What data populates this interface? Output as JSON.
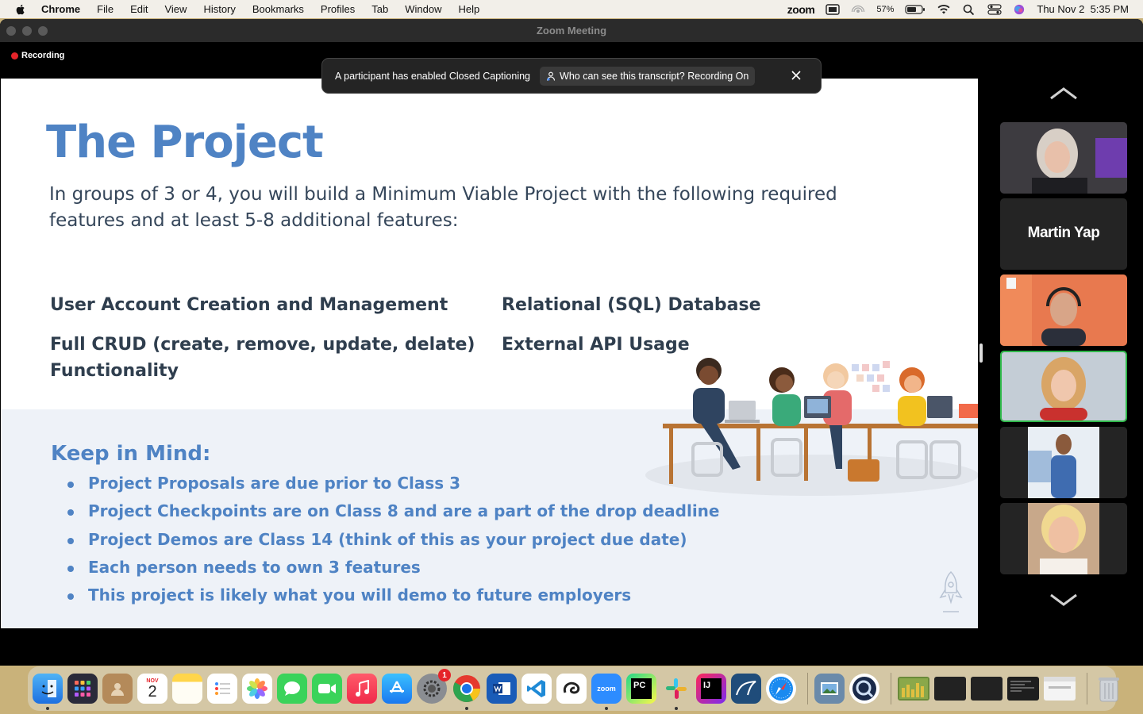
{
  "menubar": {
    "items": [
      "Chrome",
      "File",
      "Edit",
      "View",
      "History",
      "Bookmarks",
      "Profiles",
      "Tab",
      "Window",
      "Help"
    ],
    "zoom_label": "zoom",
    "battery": "57%",
    "datetime": "Thu Nov 2  5:35 PM"
  },
  "window": {
    "title": "Zoom Meeting",
    "recording_label": "Recording"
  },
  "cc_banner": {
    "message": "A participant has enabled Closed Captioning",
    "transcript_label": "Who can see this transcript? Recording On"
  },
  "slide": {
    "title": "The Project",
    "intro": "In groups of 3 or 4, you will build a Minimum Viable Project with the following required features and at least 5-8 additional features:",
    "features": [
      "User Account Creation and Management",
      "Relational (SQL) Database",
      "Full CRUD (create, remove, update, delate) Functionality",
      "External API Usage"
    ],
    "keep_title": "Keep in Mind:",
    "keep_items": [
      "Project Proposals are due prior to Class 3",
      "Project Checkpoints are on Class 8 and are a part of the drop deadline",
      "Project Demos are Class 14 (think of this as your project due date)",
      "Each person needs to own 3 features",
      "This project is likely what you will demo to future employers"
    ]
  },
  "participants": {
    "name_tile": "Martin Yap"
  },
  "dock": {
    "calendar_month": "NOV",
    "calendar_day": "2",
    "settings_badge": "1",
    "zoom_label": "zoom",
    "pycharm_label": "PC",
    "intellij_label": "IJ"
  },
  "colors": {
    "slide_blue": "#4f83c4",
    "slide_dark": "#2f3e4e",
    "active_speaker": "#2fb84a",
    "recording_red": "#e5242a"
  }
}
